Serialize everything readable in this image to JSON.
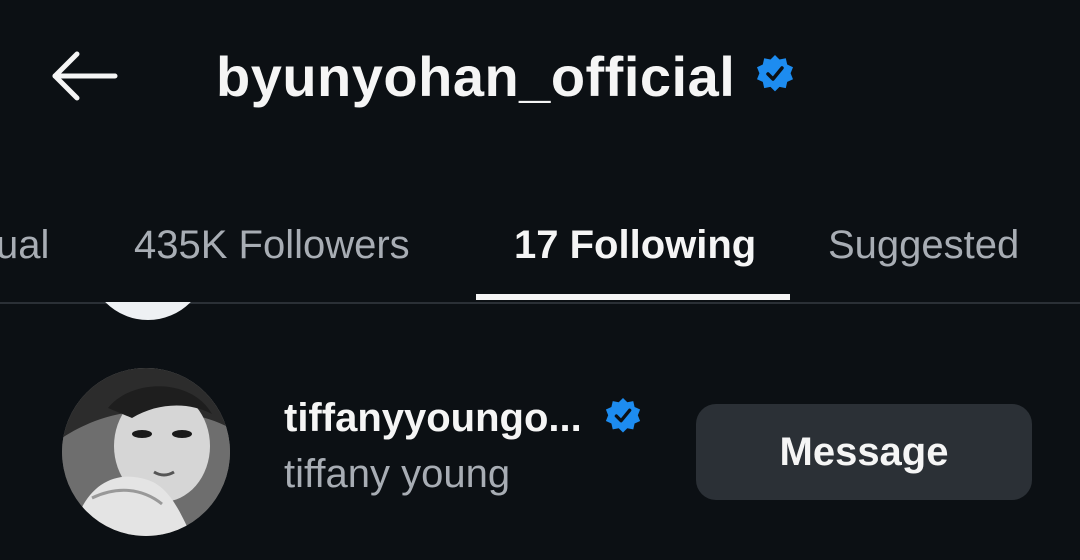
{
  "header": {
    "back_icon": "arrow-left-icon",
    "username": "byunyohan_official",
    "verified_icon": "verified-badge-icon"
  },
  "tabs": [
    {
      "label": "ual",
      "active": false
    },
    {
      "label": "435K Followers",
      "active": false
    },
    {
      "label": "17 Following",
      "active": true
    },
    {
      "label": "Suggested",
      "active": false
    }
  ],
  "following_list": [
    {
      "username": "tiffanyyoungo...",
      "full_name": "tiffany young",
      "verified": true,
      "button_label": "Message"
    }
  ],
  "colors": {
    "background": "#0c1014",
    "verified_blue": "#1d8cf0",
    "button_bg": "#2b3036",
    "secondary_text": "#a8adb4"
  }
}
